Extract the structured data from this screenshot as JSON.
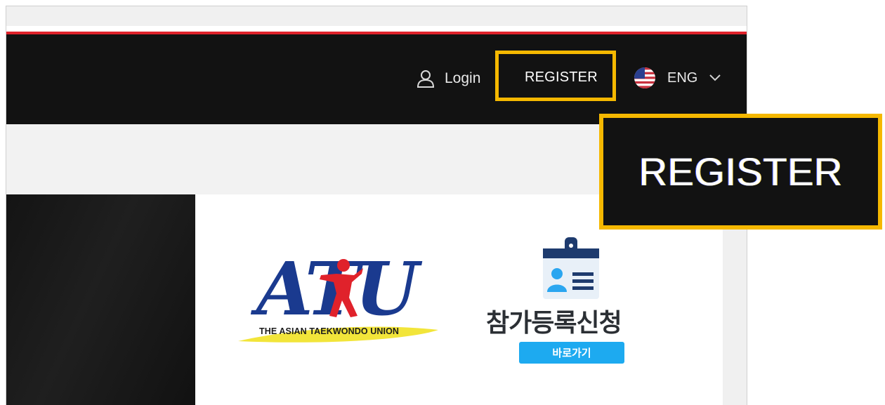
{
  "navbar": {
    "login_label": "Login",
    "register_label": "REGISTER",
    "language_label": "ENG",
    "icons": [
      "user-icon",
      "us-flag-icon",
      "chevron-down-icon"
    ]
  },
  "zoom_callout": {
    "label": "REGISTER"
  },
  "content": {
    "atu_logo_caption": "THE ASIAN TAEKWONDO UNION",
    "atu_logo_letters": "ATU",
    "registration_title": "참가등록신청",
    "registration_button": "바로가기"
  },
  "colors": {
    "highlight": "#f5b800",
    "navbar_bg": "#121212",
    "accent_red": "#e0222b",
    "button_blue": "#1daaf0",
    "logo_blue": "#1a3a8f",
    "logo_red": "#e0222b",
    "logo_yellow": "#f2e53a"
  }
}
